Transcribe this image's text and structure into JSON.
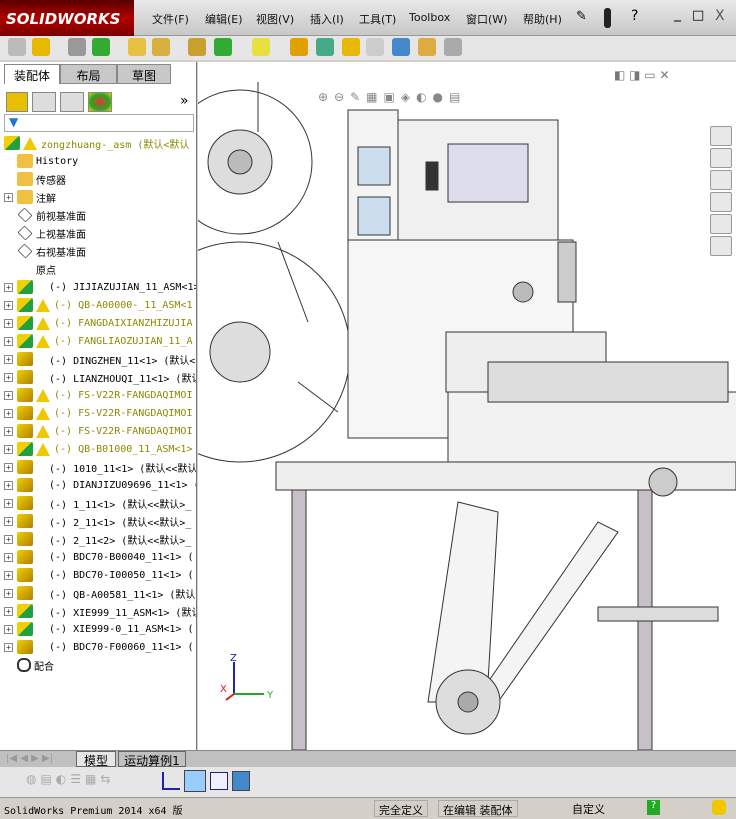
{
  "app": {
    "logo": "SOLIDWORKS"
  },
  "menu": [
    "文件(F)",
    "编辑(E)",
    "视图(V)",
    "插入(I)",
    "工具(T)",
    "Toolbox",
    "窗口(W)",
    "帮助(H)"
  ],
  "window_controls": {
    "help": "?",
    "minimize": "_",
    "restore": "□",
    "close": "X"
  },
  "command_tabs": [
    "装配体",
    "布局",
    "草图"
  ],
  "panel_more": "»",
  "tree": {
    "root": "zongzhuang-_asm  (默认<默认",
    "fixed": [
      "History",
      "传感器",
      "注解",
      "前视基准面",
      "上视基准面",
      "右视基准面",
      "原点"
    ],
    "components": [
      {
        "label": "(-) JIJIAZUJIAN_11_ASM<1>",
        "warn": false,
        "asm": true
      },
      {
        "label": "(-) QB-A00000-_11_ASM<1",
        "warn": true,
        "asm": true
      },
      {
        "label": "(-) FANGDAIXIANZHIZUJIA",
        "warn": true,
        "asm": true
      },
      {
        "label": "(-) FANGLIAOZUJIAN_11_A",
        "warn": true,
        "asm": true
      },
      {
        "label": "(-) DINGZHEN_11<1> (默认<",
        "warn": false,
        "asm": false
      },
      {
        "label": "(-) LIANZHOUQI_11<1> (默认",
        "warn": false,
        "asm": false
      },
      {
        "label": "(-) FS-V22R-FANGDAQIMOI",
        "warn": true,
        "asm": false
      },
      {
        "label": "(-) FS-V22R-FANGDAQIMOI",
        "warn": true,
        "asm": false
      },
      {
        "label": "(-) FS-V22R-FANGDAQIMOI",
        "warn": true,
        "asm": false
      },
      {
        "label": "(-) QB-B01000_11_ASM<1>",
        "warn": true,
        "asm": true
      },
      {
        "label": "(-) 1010_11<1> (默认<<默认",
        "warn": false,
        "asm": false
      },
      {
        "label": "(-) DIANJIZU09696_11<1> (",
        "warn": false,
        "asm": false
      },
      {
        "label": "(-) 1_11<1> (默认<<默认>_",
        "warn": false,
        "asm": false
      },
      {
        "label": "(-) 2_11<1> (默认<<默认>_",
        "warn": false,
        "asm": false
      },
      {
        "label": "(-) 2_11<2> (默认<<默认>_",
        "warn": false,
        "asm": false
      },
      {
        "label": "(-) BDC70-B00040_11<1> (",
        "warn": false,
        "asm": false
      },
      {
        "label": "(-) BDC70-I00050_11<1> (",
        "warn": false,
        "asm": false
      },
      {
        "label": "(-) QB-A00581_11<1> (默认",
        "warn": false,
        "asm": false
      },
      {
        "label": "(-) XIE999_11_ASM<1> (默认",
        "warn": false,
        "asm": true
      },
      {
        "label": "(-) XIE999-0_11_ASM<1> (",
        "warn": false,
        "asm": true
      },
      {
        "label": "(-) BDC70-F00060_11<1> (",
        "warn": false,
        "asm": false
      }
    ],
    "mates": "配合"
  },
  "bottom_tabs": [
    "模型",
    "运动算例1"
  ],
  "triad": {
    "x": "X",
    "y": "Y",
    "z": "Z"
  },
  "status": {
    "product": "SolidWorks Premium 2014 x64 版",
    "defined": "完全定义",
    "editing": "在编辑 装配体",
    "units": "自定义",
    "help": "?"
  }
}
